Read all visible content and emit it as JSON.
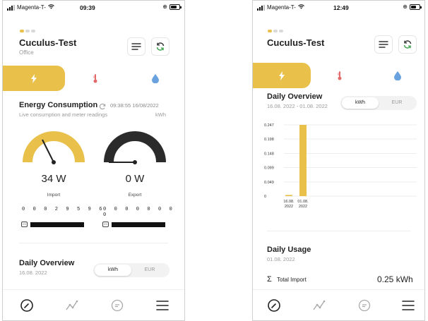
{
  "colors": {
    "accent": "#e8c04a",
    "dark_gauge": "#2b2b2b",
    "muted": "#9a9a9a"
  },
  "left": {
    "status": {
      "carrier": "Magenta-T-",
      "time": "09:39"
    },
    "header": {
      "title": "Cuculus-Test",
      "subtitle": "Office"
    },
    "tabs": [
      {
        "icon": "lightning-icon",
        "active": true
      },
      {
        "icon": "thermometer-icon",
        "active": false
      },
      {
        "icon": "water-drop-icon",
        "active": false
      }
    ],
    "energy": {
      "title": "Energy Consumption",
      "timestamp": "09:38:55 16/08/2022",
      "description": "Live consumption and meter readings",
      "unit": "kWh"
    },
    "import": {
      "value": "34 W",
      "label": "Import",
      "meter": "0 0 0 2 9 5 9 6",
      "fill": 0.72
    },
    "export": {
      "value": "0 W",
      "label": "Export",
      "meter": "0 0 0 0 0 0 0 0",
      "fill": 0.0
    },
    "daily": {
      "title": "Daily Overview",
      "date": "16.08. 2022",
      "toggle": [
        "kWh",
        "EUR"
      ],
      "selected": "kWh"
    }
  },
  "right": {
    "status": {
      "carrier": "Magenta-T-",
      "time": "12:49"
    },
    "header": {
      "title": "Cuculus-Test"
    },
    "daily": {
      "title": "Daily Overview",
      "range": "16.08. 2022 - 01.08. 2022",
      "toggle": [
        "kWh",
        "EUR"
      ],
      "selected": "kWh"
    },
    "usage": {
      "title": "Daily Usage",
      "date": "01.08. 2022",
      "total_label": "Total Import",
      "total_value": "0.25 kWh",
      "sigma": "Σ"
    }
  },
  "chart_data": {
    "type": "bar",
    "categories": [
      "16.08.\n2022",
      "01.08.\n2022"
    ],
    "values": [
      0.004,
      0.247
    ],
    "yticks": [
      0,
      0.049,
      0.099,
      0.148,
      0.198,
      0.247
    ],
    "ylim": [
      0,
      0.247
    ],
    "grid": true,
    "color": "#e8c04a"
  }
}
